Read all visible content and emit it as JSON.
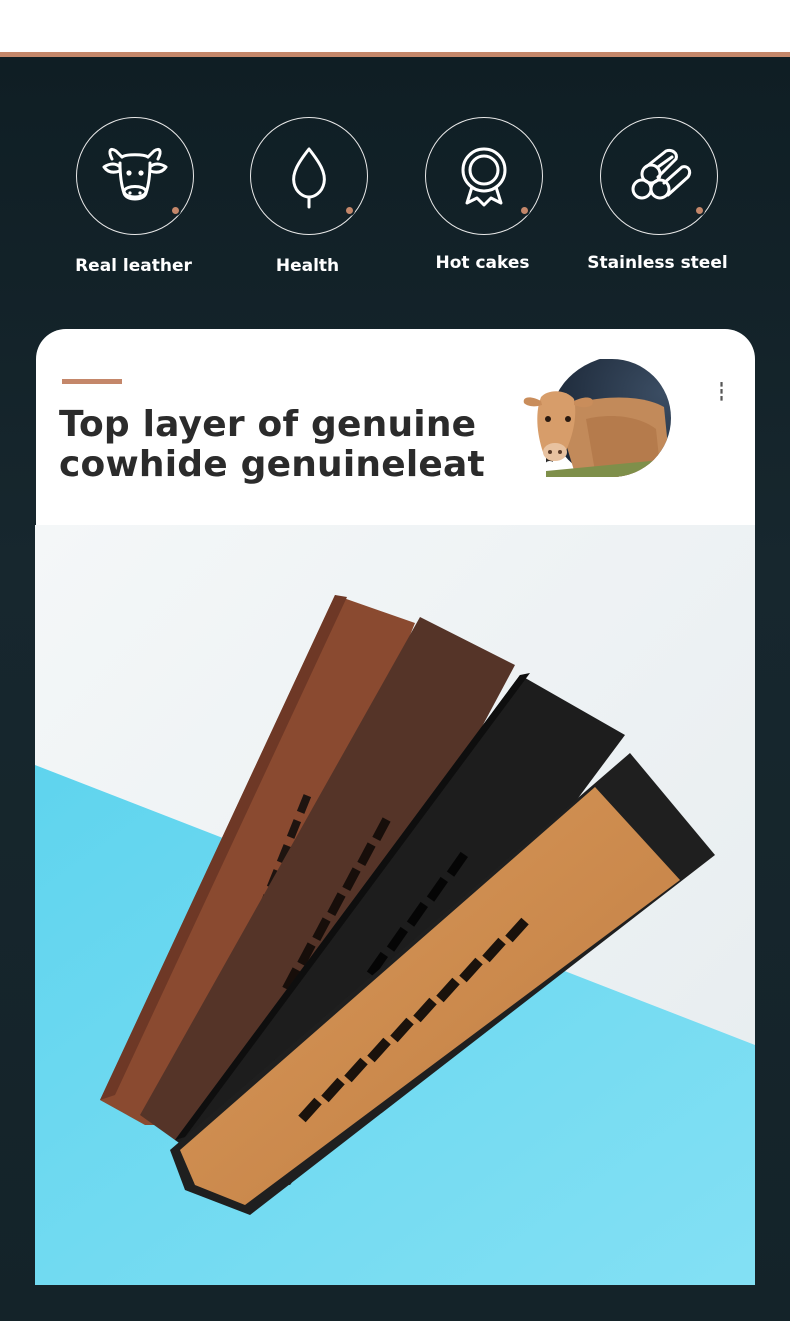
{
  "features": [
    {
      "label": "Real leather",
      "icon": "cow-head-icon"
    },
    {
      "label": "Health",
      "icon": "leaf-icon"
    },
    {
      "label": "Hot cakes",
      "icon": "award-medal-icon"
    },
    {
      "label": "Stainless steel",
      "icon": "steel-rods-icon"
    }
  ],
  "card": {
    "headline_line1": "Top layer of genuine",
    "headline_line2": "cowhide genuineleather"
  },
  "colors": {
    "accent": "#c4876a",
    "background": "#132127",
    "card": "#ffffff",
    "headline": "#2b2b2b"
  },
  "photo": {
    "subject": "leather-watch-straps-photo",
    "strap_colors": [
      "#8a4a30",
      "#5a3a2c",
      "#1c1c1c",
      "#c98a4e"
    ]
  }
}
